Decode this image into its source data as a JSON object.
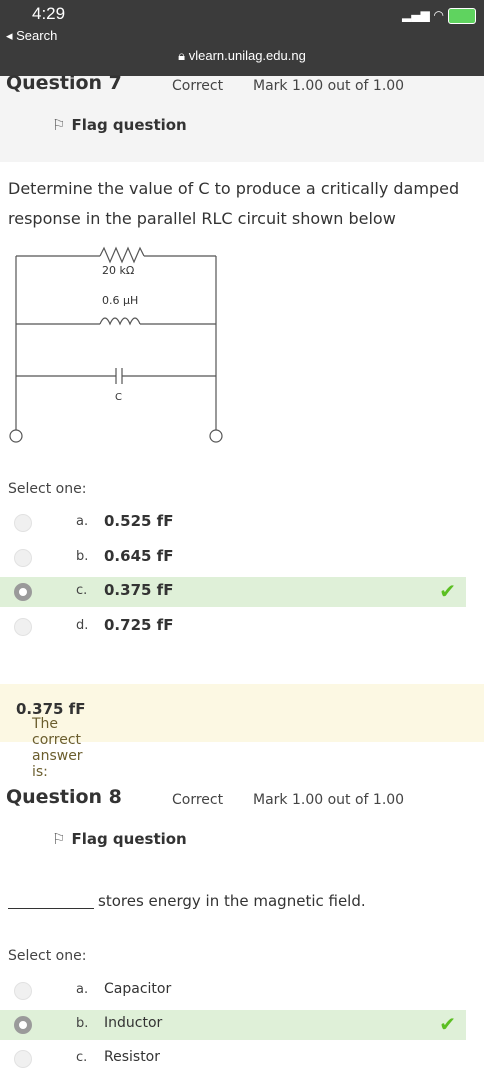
{
  "status_bar": {
    "time": "4:29",
    "back_label": "◂ Search",
    "url": "vlearn.unilag.edu.ng"
  },
  "question7": {
    "title": "Question 7",
    "state": "Correct",
    "grade": "Mark 1.00 out of 1.00",
    "flag_label": "Flag question",
    "text": "Determine the value of C to produce a critically damped response in the parallel RLC circuit shown below",
    "circuit": {
      "resistor_label": "20 kΩ",
      "inductor_label": "0.6 µH",
      "capacitor_label": "C"
    },
    "select_label": "Select one:",
    "options": [
      {
        "letter": "a.",
        "text": "0.525 fF"
      },
      {
        "letter": "b.",
        "text": "0.645 fF"
      },
      {
        "letter": "c.",
        "text": "0.375 fF"
      },
      {
        "letter": "d.",
        "text": "0.725 fF"
      }
    ],
    "feedback_prefix": "The correct answer is:",
    "feedback_answer": "0.375 fF"
  },
  "question8": {
    "title": "Question 8",
    "state": "Correct",
    "grade": "Mark 1.00 out of 1.00",
    "flag_label": "Flag question",
    "text": "stores energy in the magnetic field.",
    "select_label": "Select one:",
    "options": [
      {
        "letter": "a.",
        "text": "Capacitor"
      },
      {
        "letter": "b.",
        "text": "Inductor"
      },
      {
        "letter": "c.",
        "text": "Resistor"
      }
    ]
  }
}
